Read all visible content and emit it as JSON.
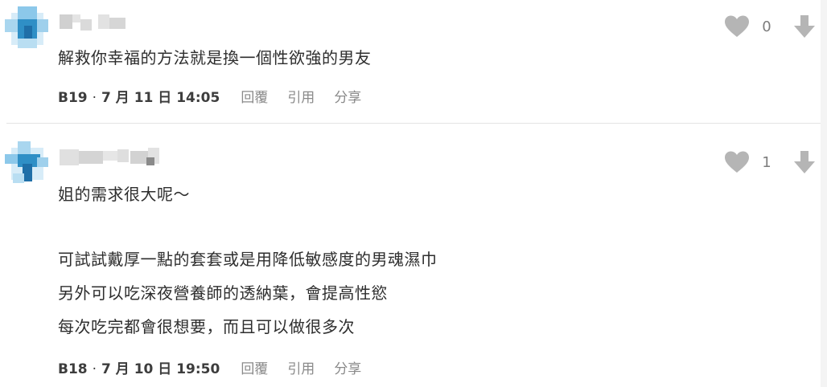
{
  "colors": {
    "icon_gray": "#b5b5b5",
    "meta_gray": "#8a8a8a",
    "text_dark": "#2e2e2e",
    "avatar_blue": "#2f8fc6",
    "avatar_light": "#a9d6ef"
  },
  "comments": [
    {
      "floor": "B19",
      "date": "7 月 11 日 14:05",
      "lines": [
        "解救你幸福的方法就是換一個性欲強的男友"
      ],
      "likes": "0",
      "actions": {
        "reply": "回覆",
        "quote": "引用",
        "share": "分享"
      },
      "icons": {
        "like": "heart-icon",
        "dislike": "down-arrow-icon"
      }
    },
    {
      "floor": "B18",
      "date": "7 月 10 日 19:50",
      "lines": [
        "姐的需求很大呢～",
        "可試試戴厚一點的套套或是用降低敏感度的男魂濕巾",
        "另外可以吃深夜營養師的透納葉，會提高性慾",
        "每次吃完都會很想要，而且可以做很多次"
      ],
      "likes": "1",
      "actions": {
        "reply": "回覆",
        "quote": "引用",
        "share": "分享"
      },
      "icons": {
        "like": "heart-icon",
        "dislike": "down-arrow-icon"
      }
    }
  ]
}
